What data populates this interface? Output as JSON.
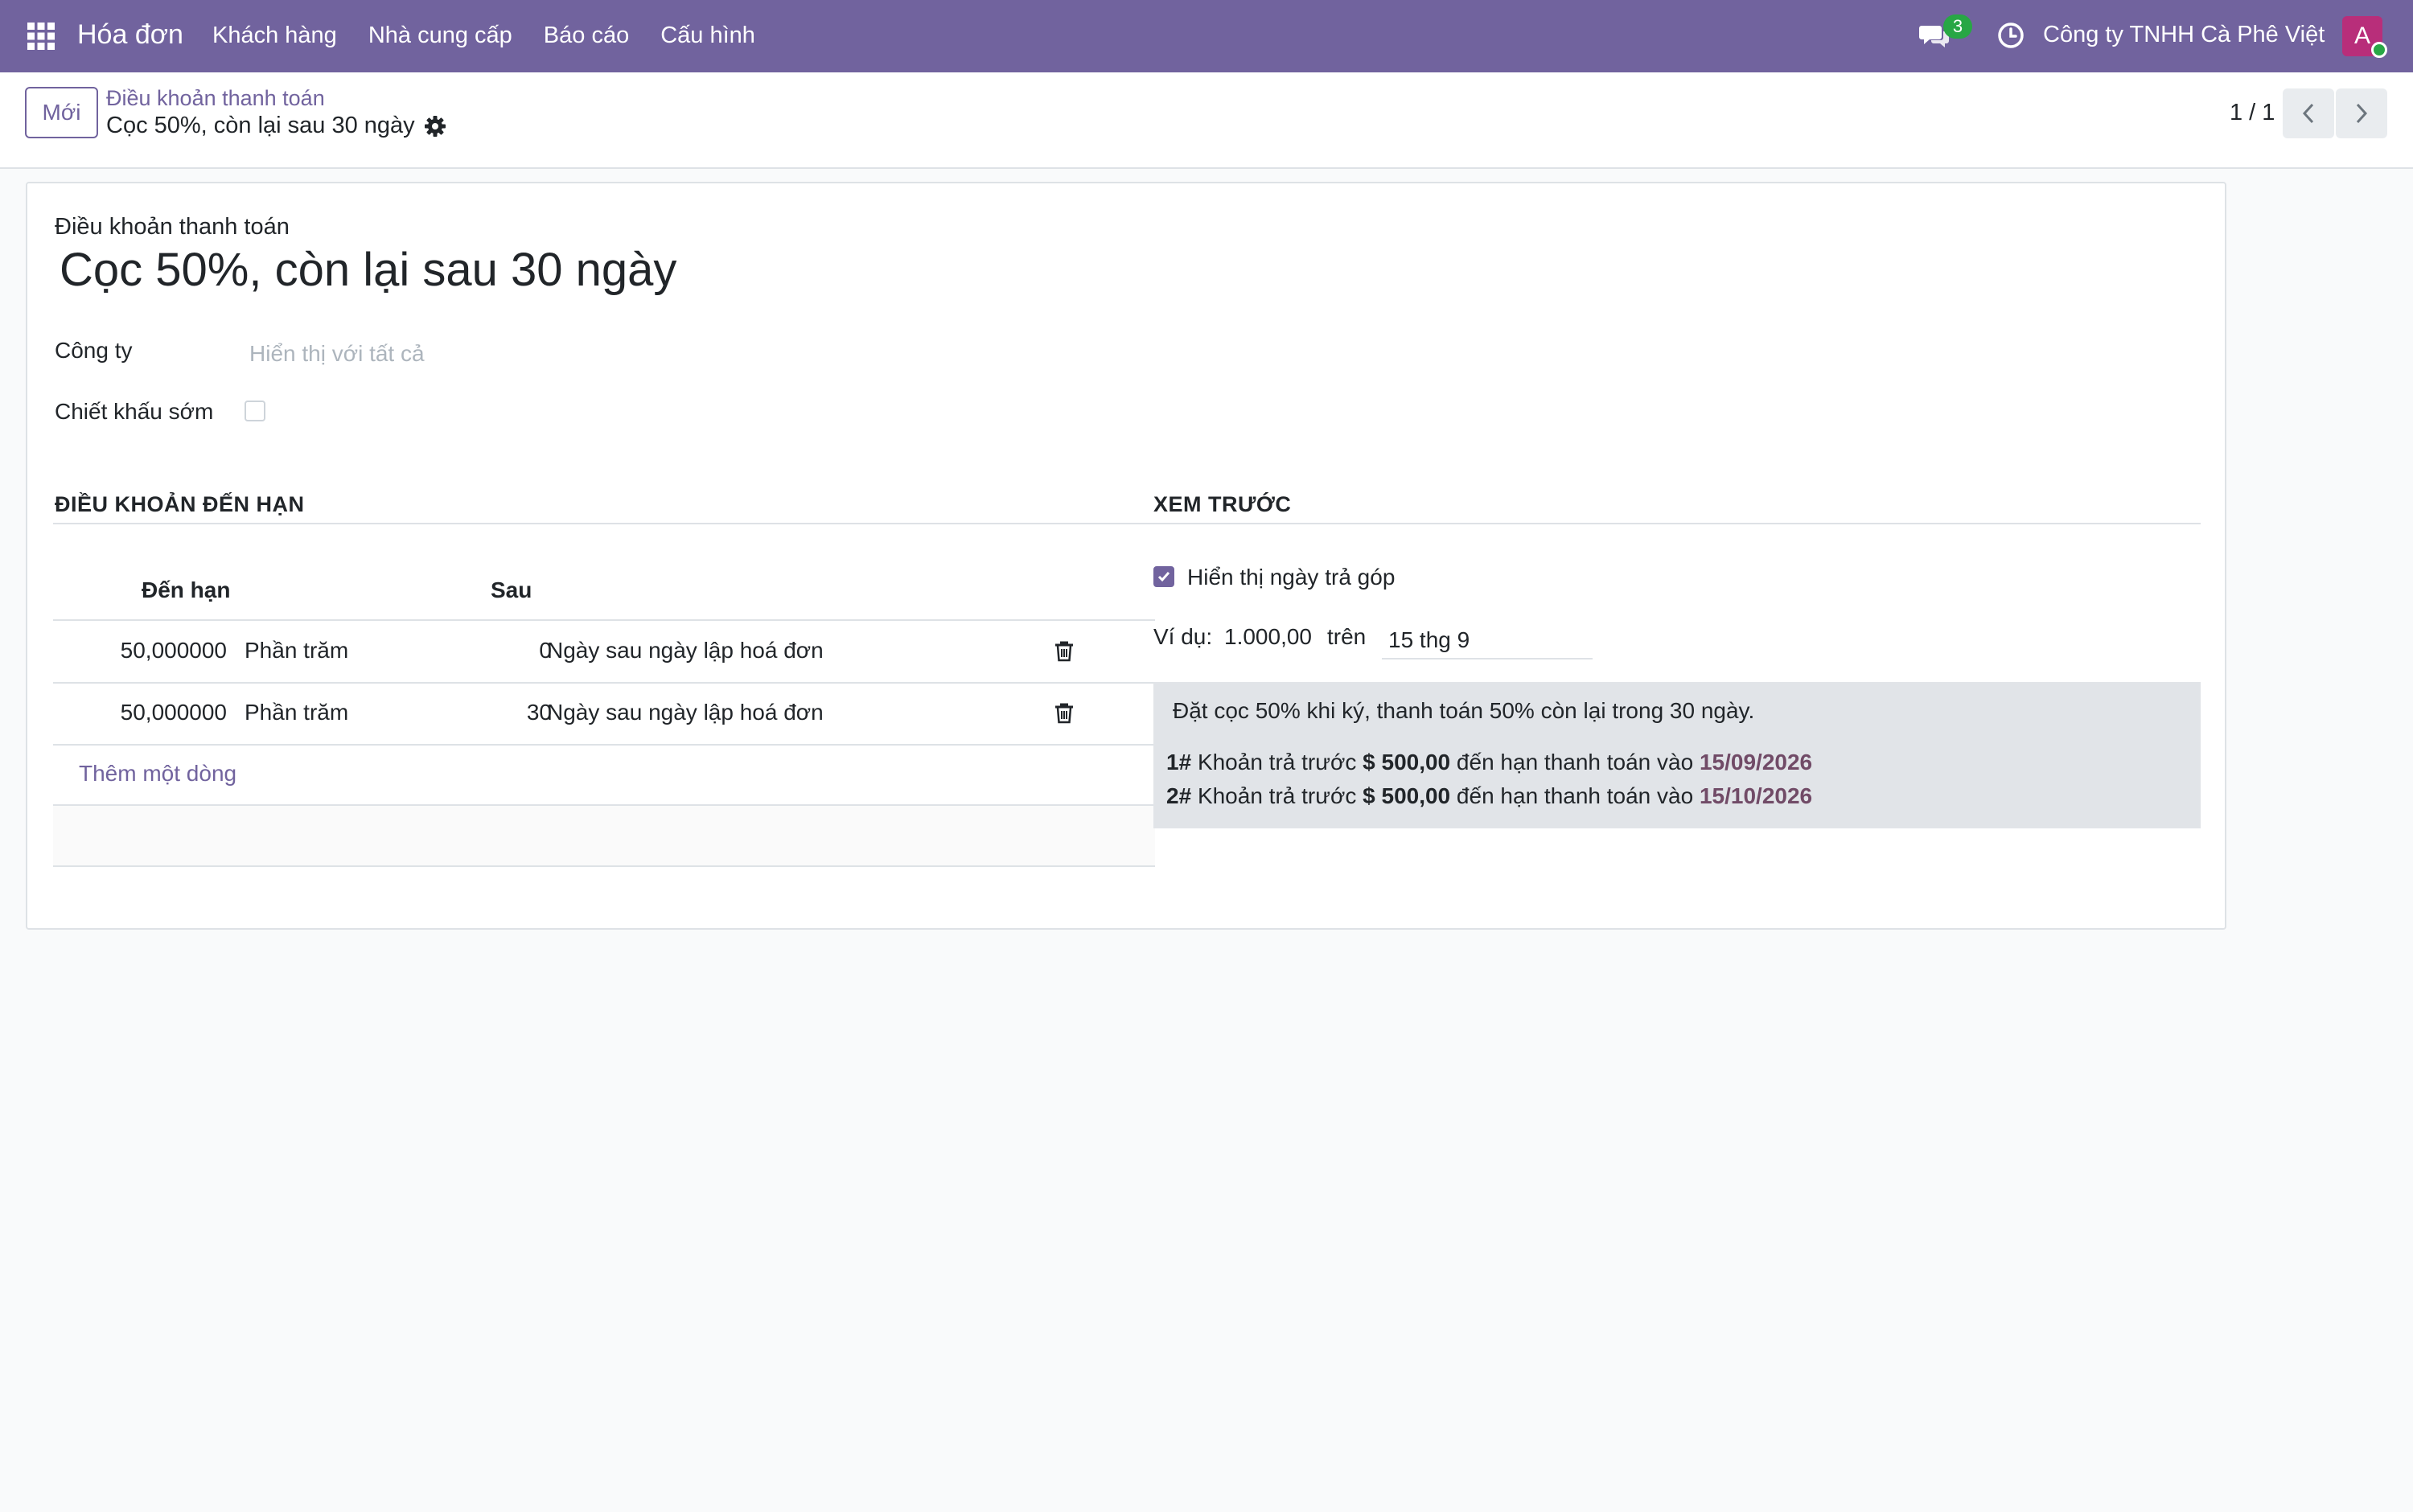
{
  "navbar": {
    "brand": "Hóa đơn",
    "menu": [
      "Khách hàng",
      "Nhà cung cấp",
      "Báo cáo",
      "Cấu hình"
    ],
    "chat_count": "3",
    "company": "Công ty TNHH Cà Phê Việt",
    "avatar_letter": "A",
    "icons": [
      "apps-grid-icon",
      "chat-icon",
      "clock-icon"
    ]
  },
  "control": {
    "new_label": "Mới",
    "breadcrumb_parent": "Điều khoản thanh toán",
    "breadcrumb_current": "Cọc 50%, còn lại sau 30 ngày",
    "pager": "1 / 1"
  },
  "form": {
    "name_label": "Điều khoản thanh toán",
    "name": "Cọc 50%, còn lại sau 30 ngày",
    "company_label": "Công ty",
    "company_placeholder": "Hiển thị với tất cả",
    "early_discount_label": "Chiết khấu sớm",
    "early_discount_checked": false
  },
  "terms": {
    "section_title": "ĐIỀU KHOẢN ĐẾN HẠN",
    "columns": [
      "Đến hạn",
      "Sau"
    ],
    "rows": [
      {
        "value": "50,000000",
        "value_type": "Phần trăm",
        "days": "0",
        "delay_type": "Ngày sau ngày lập hoá đơn"
      },
      {
        "value": "50,000000",
        "value_type": "Phần trăm",
        "days": "30",
        "delay_type": "Ngày sau ngày lập hoá đơn"
      }
    ],
    "add_line": "Thêm một dòng"
  },
  "preview": {
    "section_title": "XEM TRƯỚC",
    "show_installments_label": "Hiển thị ngày trả góp",
    "show_installments_checked": true,
    "example_label": "Ví dụ:",
    "example_amount": "1.000,00",
    "on_label": "trên",
    "example_date": "15 thg 9",
    "note": "Đặt cọc 50% khi ký, thanh toán 50% còn lại trong 30 ngày.",
    "installments": [
      {
        "index": "1#",
        "text": "Khoản trả trước",
        "amount": "$ 500,00",
        "due_text": "đến hạn thanh toán vào",
        "date": "15/09/2026"
      },
      {
        "index": "2#",
        "text": "Khoản trả trước",
        "amount": "$ 500,00",
        "due_text": "đến hạn thanh toán vào",
        "date": "15/10/2026"
      }
    ]
  },
  "colors": {
    "navbar": "#71639e",
    "accent_date": "#714b67",
    "badge": "#28a745",
    "avatar": "#b82e7a"
  }
}
